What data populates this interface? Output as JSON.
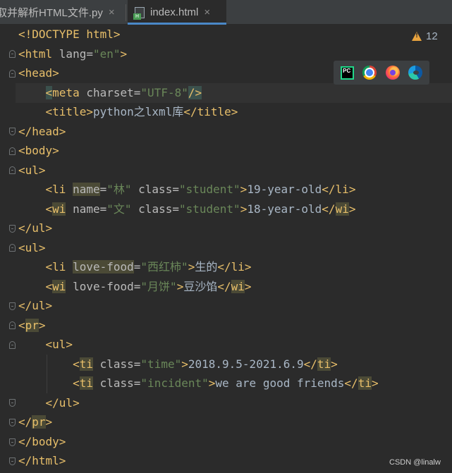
{
  "tabs": [
    {
      "label": "取并解析HTML文件.py",
      "close": "×"
    },
    {
      "label": "index.html",
      "close": "×",
      "icon_text": "H"
    }
  ],
  "inspection": {
    "count": "12"
  },
  "browser_toolbar": {
    "pc_text": "PC",
    "icons": [
      "pycharm-icon",
      "chrome-icon",
      "firefox-icon",
      "edge-icon"
    ]
  },
  "code_lines": [
    "<!DOCTYPE html>",
    "<html lang=\"en\">",
    "<head>",
    "    <meta charset=\"UTF-8\"/>",
    "    <title>python之lxml库</title>",
    "</head>",
    "<body>",
    "<ul>",
    "    <li name=\"林\" class=\"student\">19-year-old</li>",
    "    <wi name=\"文\" class=\"student\">18-year-old</wi>",
    "</ul>",
    "<ul>",
    "    <li love-food=\"西红柿\">生的</li>",
    "    <wi love-food=\"月饼\">豆沙馅</wi>",
    "</ul>",
    "<pr>",
    "    <ul>",
    "        <ti class=\"time\">2018.9.5-2021.6.9</ti>",
    "        <ti class=\"incident\">we are good friends</ti>",
    "    </ul>",
    "</pr>",
    "</body>",
    "</html>"
  ],
  "watermark": "CSDN @linalw",
  "colors": {
    "tag": "#e8bf6a",
    "attr": "#bababa",
    "value": "#6a8759",
    "text": "#a9b7c6",
    "background": "#2b2b2b",
    "warning": "#e8a33e"
  }
}
